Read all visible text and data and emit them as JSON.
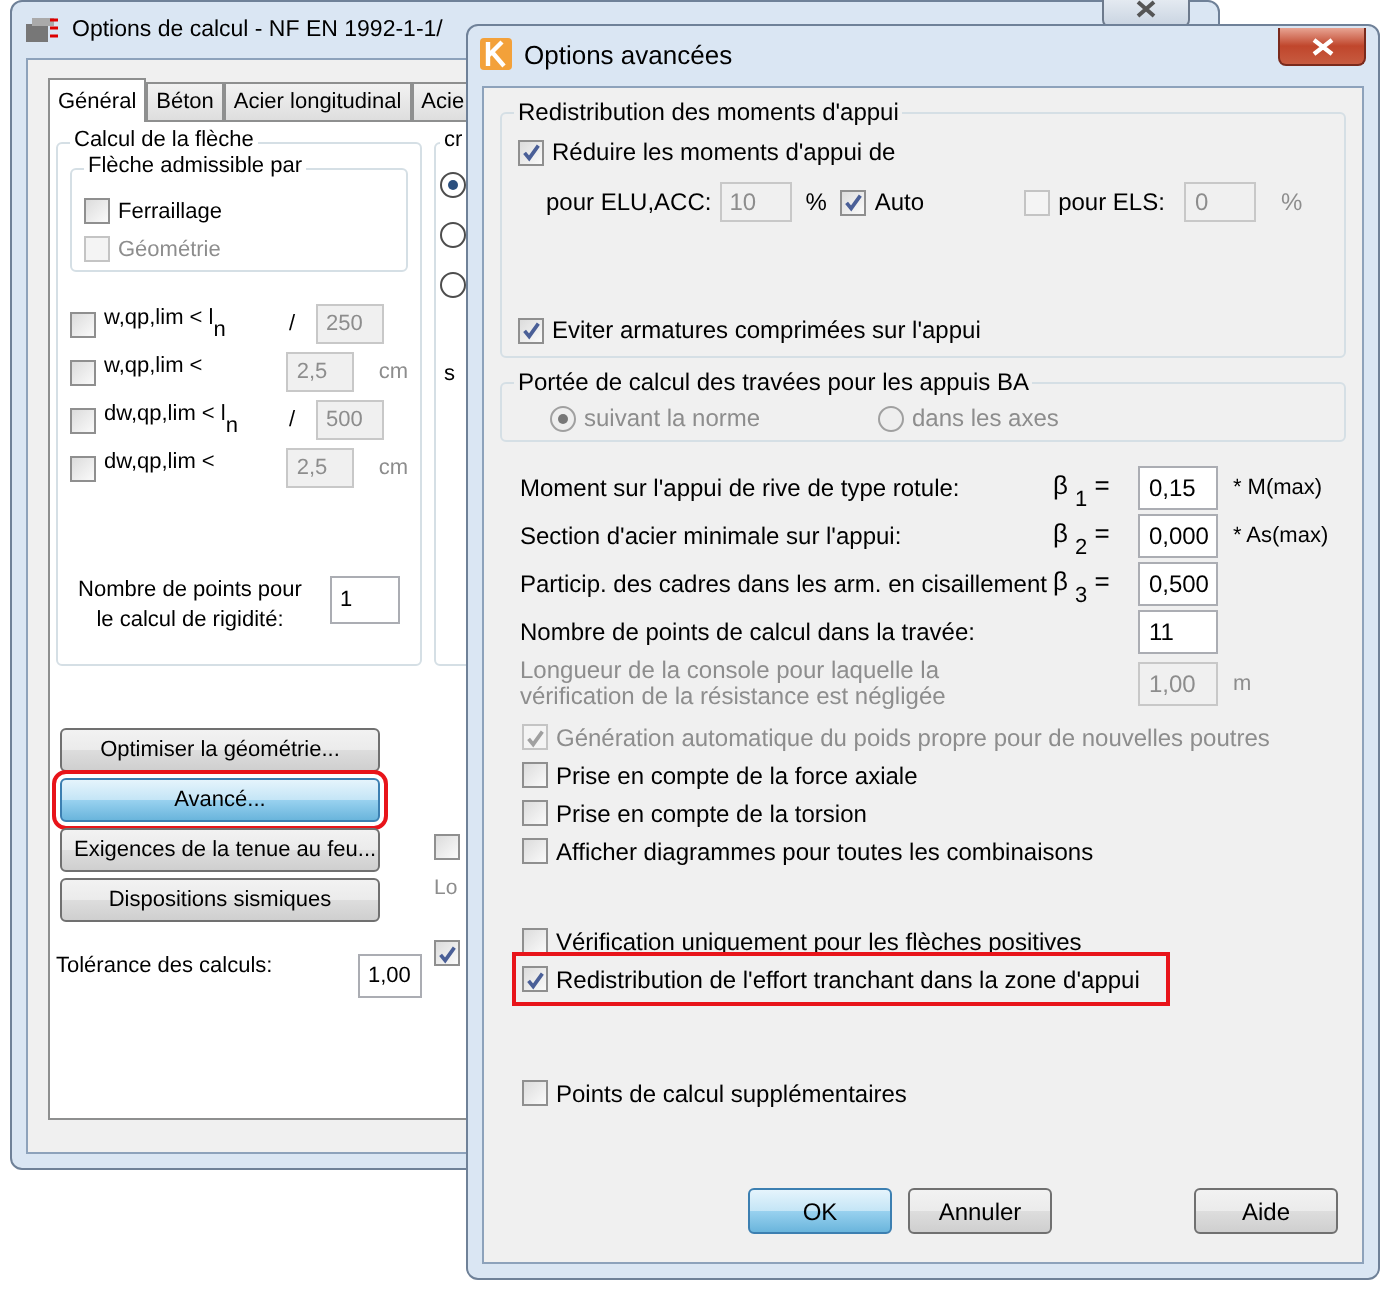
{
  "back_window": {
    "title": "Options de calcul - NF EN 1992-1-1/",
    "tabs": [
      {
        "label": "Général",
        "selected": true
      },
      {
        "label": "Béton",
        "selected": false
      },
      {
        "label": "Acier longitudinal",
        "selected": false
      },
      {
        "label": "Acie",
        "selected": false
      }
    ],
    "deflection": {
      "title": "Calcul de la flèche",
      "admissible_title": "Flèche admissible par",
      "admissible_options": [
        {
          "label": "Ferraillage",
          "checked": false,
          "disabled": false
        },
        {
          "label": "Géométrie",
          "checked": false,
          "disabled": true
        }
      ],
      "limits": [
        {
          "label": "w,qp,lim < l$_{n}$",
          "checked": false,
          "separator": "/",
          "value": "250"
        },
        {
          "label": "w,qp,lim <",
          "checked": false,
          "value": "2,5",
          "unit": "cm"
        },
        {
          "label": "dw,qp,lim < l$_{n}$",
          "checked": false,
          "separator": "/",
          "value": "500"
        },
        {
          "label": "dw,qp,lim <",
          "checked": false,
          "value": "2,5",
          "unit": "cm"
        }
      ],
      "rigidity_label": "Nombre de points pour le calcul de rigidité:",
      "rigidity_value": "1"
    },
    "buttons": [
      {
        "label": "Optimiser la géométrie...",
        "focused": false,
        "highlighted": false
      },
      {
        "label": "Avancé...",
        "focused": true,
        "highlighted": true
      },
      {
        "label": "Exigences de la tenue au feu...",
        "focused": false,
        "highlighted": false
      },
      {
        "label": "Dispositions sismiques",
        "focused": false,
        "highlighted": false
      }
    ],
    "tolerance": {
      "label": "Tolérance des calculs:",
      "value": "1,00"
    },
    "side": {
      "group_title": "cr",
      "radios": [
        {
          "selected": true
        },
        {
          "selected": false
        },
        {
          "selected": false
        }
      ],
      "label": "s",
      "checkbox_top": {
        "checked": false
      },
      "label_bottom": "Lo",
      "checkbox_bottom": {
        "checked": true
      }
    }
  },
  "front_window": {
    "title": "Options avancées",
    "redistribution": {
      "title": "Redistribution des moments d'appui",
      "reduce": {
        "label": "Réduire les moments d'appui de",
        "checked": true
      },
      "elu_label": "pour ELU,ACC:",
      "elu_value": "10",
      "elu_unit": "%",
      "auto": {
        "label": "Auto",
        "checked": true
      },
      "els": {
        "label": "pour ELS:",
        "checked": false,
        "value": "0",
        "unit": "%"
      },
      "avoid": {
        "label": "Eviter armatures comprimées sur l'appui",
        "checked": true
      }
    },
    "span": {
      "title": "Portée de calcul des travées pour les appuis BA",
      "radios": [
        {
          "label": "suivant la norme",
          "selected": true,
          "disabled": true
        },
        {
          "label": "dans les axes",
          "selected": false,
          "disabled": true
        }
      ]
    },
    "params": [
      {
        "kind": "beta",
        "label": "Moment sur l'appui de rive de type rotule:",
        "symbol": "β $_{1}$ =",
        "value": "0,15",
        "unit": "* M(max)"
      },
      {
        "kind": "beta",
        "label": "Section d'acier minimale sur l'appui:",
        "symbol": "β $_{2}$ =",
        "value": "0,000",
        "unit": "* As(max)"
      },
      {
        "kind": "beta",
        "label": "Particip. des cadres dans les arm. en cisaillement",
        "symbol": "β $_{3}$ =",
        "value": "0,500"
      },
      {
        "kind": "field",
        "label": "Nombre de points de calcul dans la travée:",
        "value": "11"
      },
      {
        "kind": "disabled",
        "label": "Longueur de la console pour laquelle la vérification de la résistance est négligée",
        "value": "1,00",
        "unit": "m"
      }
    ],
    "checks": [
      [
        {
          "label": "Génération automatique du poids propre pour de nouvelles poutres",
          "checked": true,
          "disabled": true,
          "highlighted": false
        },
        {
          "label": "Prise en compte de la force axiale",
          "checked": false,
          "disabled": false,
          "highlighted": false
        },
        {
          "label": "Prise en compte de la torsion",
          "checked": false,
          "disabled": false,
          "highlighted": false
        },
        {
          "label": "Afficher diagrammes pour toutes les combinaisons",
          "checked": false,
          "disabled": false,
          "highlighted": false
        }
      ],
      [
        {
          "label": "Vérification uniquement pour les flèches positives",
          "checked": false,
          "disabled": false,
          "highlighted": false
        },
        {
          "label": "Redistribution de l'effort tranchant dans la zone d'appui",
          "checked": true,
          "disabled": false,
          "highlighted": true
        }
      ],
      [
        {
          "label": "Points de calcul supplémentaires",
          "checked": false,
          "disabled": false,
          "highlighted": false
        }
      ]
    ],
    "buttons": [
      {
        "label": "OK",
        "default": true
      },
      {
        "label": "Annuler",
        "default": false
      },
      {
        "label": "Aide",
        "default": false
      }
    ]
  }
}
